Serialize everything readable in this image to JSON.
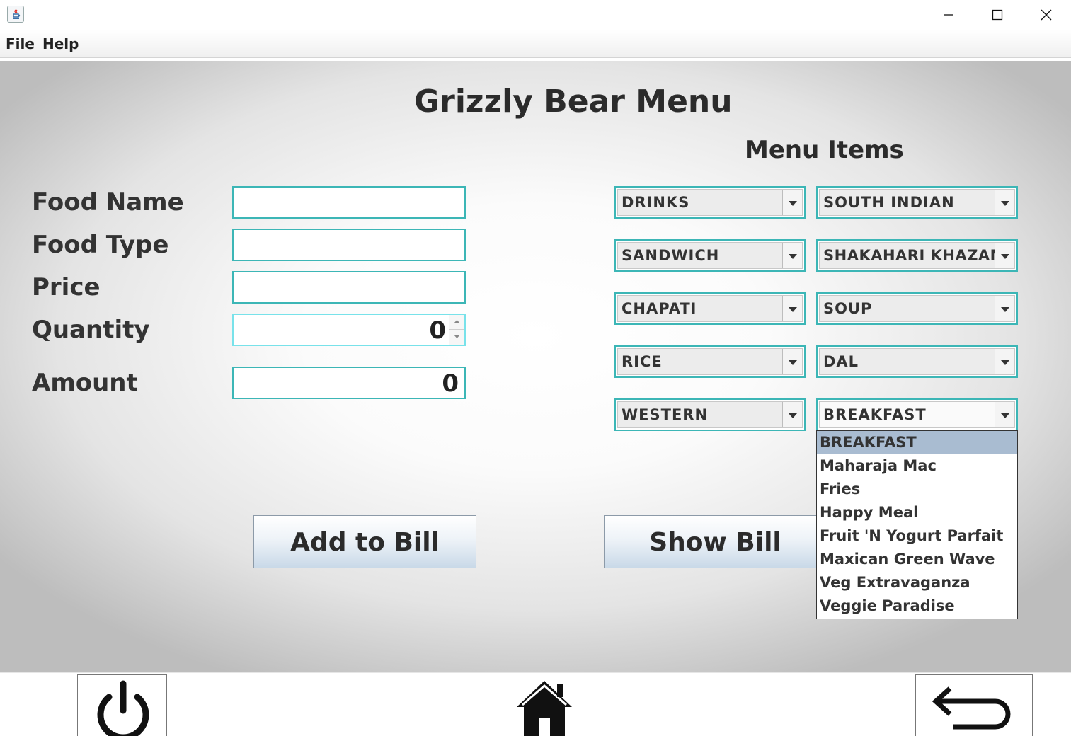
{
  "window": {
    "controls": {
      "minimize": "minimize-icon",
      "maximize": "maximize-icon",
      "close": "close-icon"
    }
  },
  "menubar": {
    "items": [
      "File",
      "Help"
    ]
  },
  "page": {
    "title": "Grizzly Bear Menu",
    "menu_heading": "Menu Items"
  },
  "form": {
    "food_name_label": "Food Name",
    "food_type_label": "Food Type",
    "price_label": "Price",
    "quantity_label": "Quantity",
    "amount_label": "Amount",
    "food_name_value": "",
    "food_type_value": "",
    "price_value": "",
    "quantity_value": "0",
    "amount_value": "0"
  },
  "combos": {
    "left": [
      "DRINKS",
      "SANDWICH",
      "CHAPATI",
      "RICE",
      "WESTERN"
    ],
    "right": [
      "SOUTH INDIAN",
      "SHAKAHARI KHAZANA",
      "SOUP",
      "DAL",
      "BREAKFAST"
    ]
  },
  "dropdown": {
    "items": [
      "BREAKFAST",
      "Maharaja Mac",
      "Fries",
      "Happy Meal",
      "Fruit 'N Yogurt Parfait",
      "Maxican Green Wave",
      "Veg Extravaganza",
      "Veggie Paradise"
    ],
    "selected": "BREAKFAST"
  },
  "buttons": {
    "add_to_bill": "Add to Bill",
    "show_bill": "Show Bill"
  },
  "bottombar": {
    "icons": [
      "power-icon",
      "home-icon",
      "back-arrow-icon"
    ]
  },
  "colors": {
    "field_border": "#3cb6b6",
    "selected_item": "#a9bcd1",
    "button_gradient_end": "#c9d9e8"
  }
}
